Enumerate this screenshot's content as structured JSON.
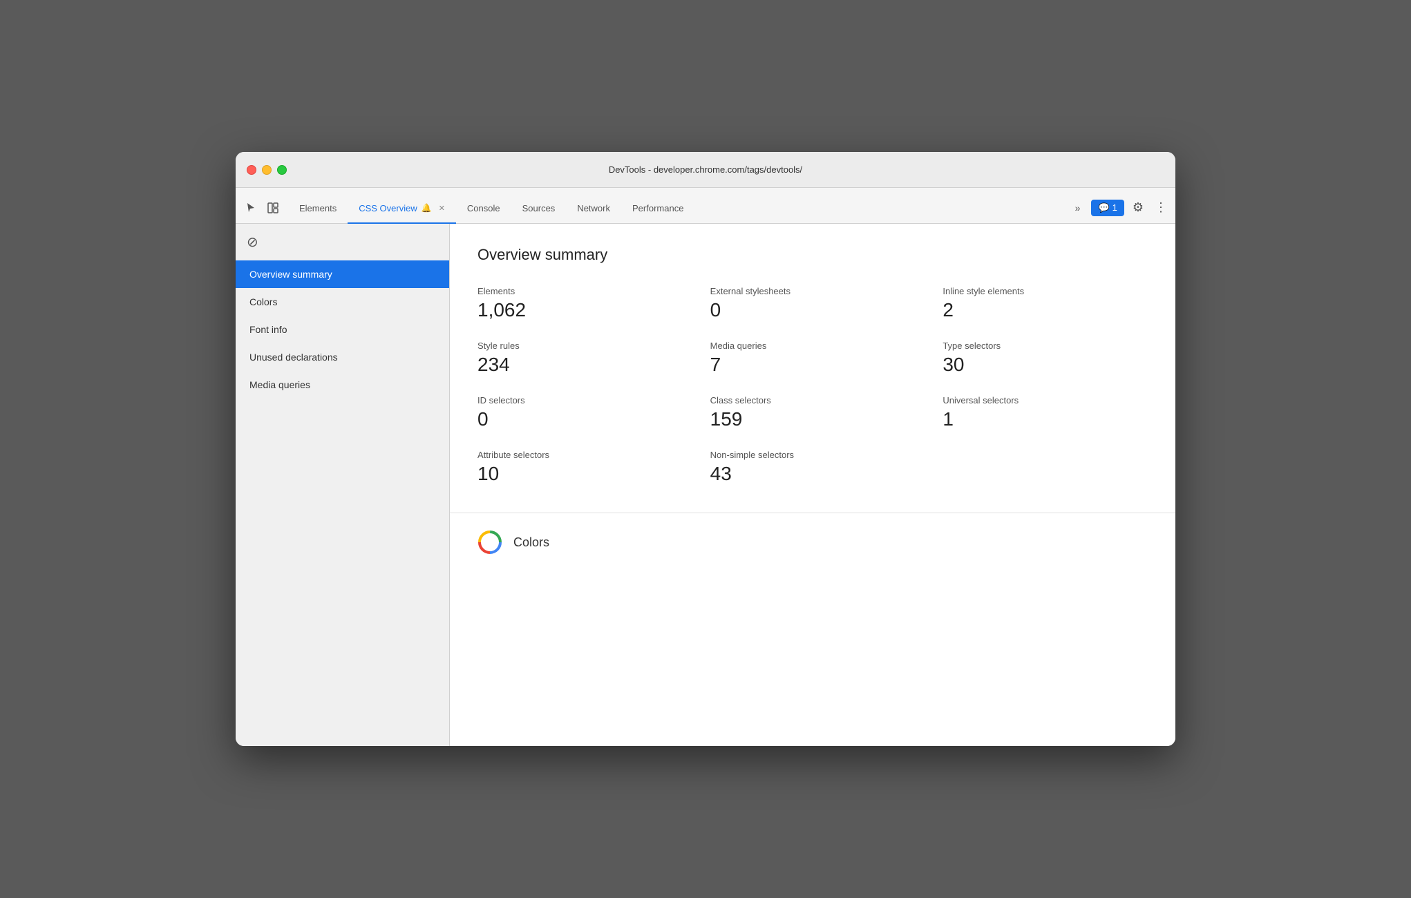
{
  "window": {
    "title": "DevTools - developer.chrome.com/tags/devtools/"
  },
  "tabs": [
    {
      "id": "elements",
      "label": "Elements",
      "active": false,
      "closable": false
    },
    {
      "id": "css-overview",
      "label": "CSS Overview",
      "active": true,
      "closable": true,
      "has_bell": true
    },
    {
      "id": "console",
      "label": "Console",
      "active": false,
      "closable": false
    },
    {
      "id": "sources",
      "label": "Sources",
      "active": false,
      "closable": false
    },
    {
      "id": "network",
      "label": "Network",
      "active": false,
      "closable": false
    },
    {
      "id": "performance",
      "label": "Performance",
      "active": false,
      "closable": false
    }
  ],
  "toolbar": {
    "more_label": "»",
    "notification_count": "1",
    "settings_icon": "⚙",
    "dots_icon": "⋮"
  },
  "sidebar": {
    "block_icon": "🚫",
    "items": [
      {
        "id": "overview-summary",
        "label": "Overview summary",
        "active": true
      },
      {
        "id": "colors",
        "label": "Colors",
        "active": false
      },
      {
        "id": "font-info",
        "label": "Font info",
        "active": false
      },
      {
        "id": "unused-declarations",
        "label": "Unused declarations",
        "active": false
      },
      {
        "id": "media-queries",
        "label": "Media queries",
        "active": false
      }
    ]
  },
  "main": {
    "overview_title": "Overview summary",
    "stats": [
      {
        "label": "Elements",
        "value": "1,062"
      },
      {
        "label": "External stylesheets",
        "value": "0"
      },
      {
        "label": "Inline style elements",
        "value": "2"
      },
      {
        "label": "Style rules",
        "value": "234"
      },
      {
        "label": "Media queries",
        "value": "7"
      },
      {
        "label": "Type selectors",
        "value": "30"
      },
      {
        "label": "ID selectors",
        "value": "0"
      },
      {
        "label": "Class selectors",
        "value": "159"
      },
      {
        "label": "Universal selectors",
        "value": "1"
      },
      {
        "label": "Attribute selectors",
        "value": "10"
      },
      {
        "label": "Non-simple selectors",
        "value": "43"
      }
    ],
    "colors_section": {
      "title": "Colors"
    }
  }
}
